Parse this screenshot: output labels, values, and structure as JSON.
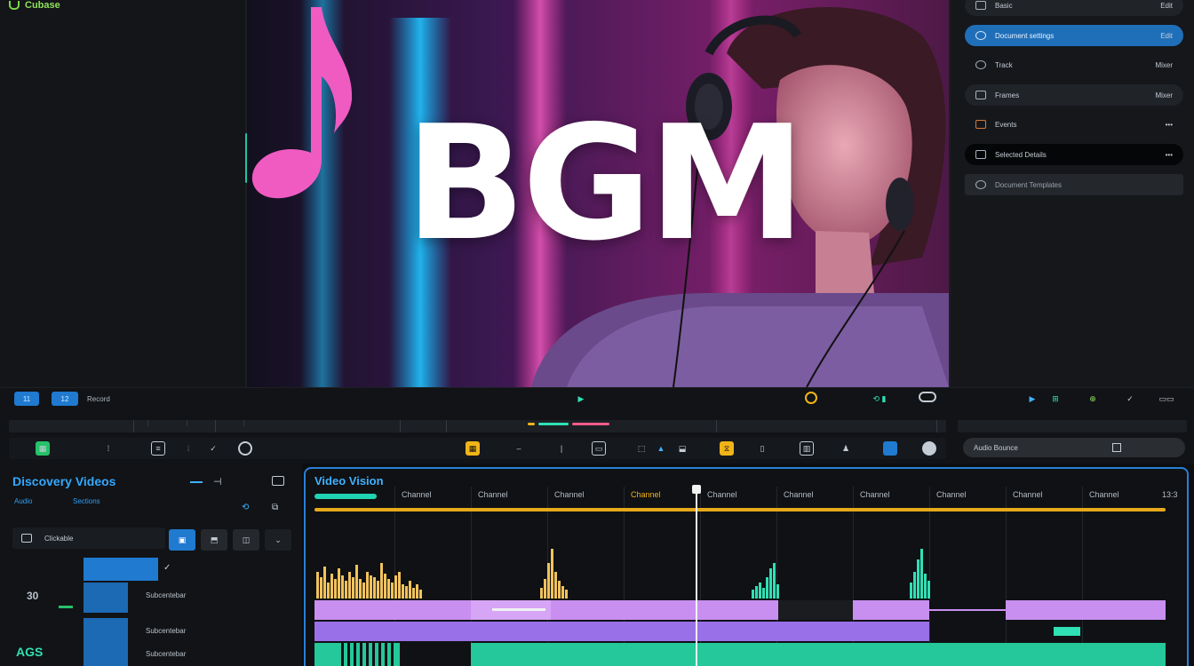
{
  "app": {
    "title": "Cubase"
  },
  "preview": {
    "overlay_text": "BGM"
  },
  "inspector": {
    "rows": [
      {
        "label": "Basic",
        "value": "Edit"
      },
      {
        "label": "Document settings",
        "value": "Edit"
      },
      {
        "label": "Track",
        "value": "Mixer"
      },
      {
        "label": "Frames",
        "value": "Mixer"
      },
      {
        "label": "Events",
        "value": "•••"
      },
      {
        "label": "Selected Details",
        "value": "•••"
      },
      {
        "label": "Document Templates",
        "value": ""
      }
    ]
  },
  "transport": {
    "btn1": "11",
    "btn2": "12",
    "label": "Record",
    "right_field": "Audio Bounce"
  },
  "project": {
    "title": "Discovery Videos",
    "sub1": "Audio",
    "sub2": "Sections",
    "search": "Clickable",
    "rows": [
      "Subcentebar",
      "Subcentebar",
      "Subcentebar"
    ],
    "left_labels": [
      "30",
      "AGS"
    ]
  },
  "timeline": {
    "title": "Video Vision",
    "columns": [
      "Channel",
      "Channel",
      "Channel",
      "Channel",
      "Channel",
      "Channel",
      "Channel",
      "Channel",
      "Channel",
      "Channel"
    ],
    "end_label": "13:3"
  },
  "colors": {
    "accent": "#1f7ad0",
    "waveform_yellow": "#f2c25b",
    "waveform_teal": "#2fe0b4",
    "clip_purple": "#c98ff0"
  }
}
